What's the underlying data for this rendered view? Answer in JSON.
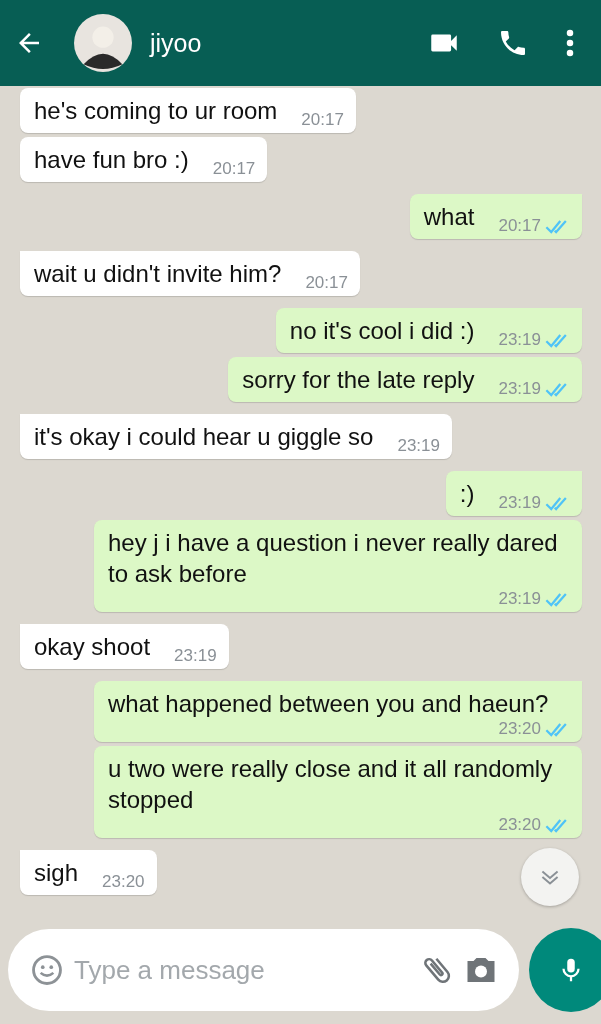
{
  "header": {
    "name": "jiyoo"
  },
  "messages": [
    {
      "kind": "incoming",
      "text": "he's coming to ur room",
      "time": "20:17",
      "tail": false
    },
    {
      "kind": "incoming",
      "text": "have fun bro :)",
      "time": "20:17",
      "tail": false
    },
    {
      "kind": "outgoing",
      "text": "what",
      "time": "20:17",
      "tail": true,
      "read": true
    },
    {
      "kind": "incoming",
      "text": "wait u didn't invite him?",
      "time": "20:17",
      "tail": true
    },
    {
      "kind": "outgoing",
      "text": "no it's cool i did :)",
      "time": "23:19",
      "tail": true,
      "read": true
    },
    {
      "kind": "outgoing",
      "text": "sorry for the late reply",
      "time": "23:19",
      "tail": false,
      "read": true
    },
    {
      "kind": "incoming",
      "text": "it's okay i could hear u giggle so",
      "time": "23:19",
      "tail": true
    },
    {
      "kind": "outgoing",
      "text": ":)",
      "time": "23:19",
      "tail": true,
      "read": true
    },
    {
      "kind": "outgoing",
      "text": "hey j i have a question i never really dared to ask before",
      "time": "23:19",
      "tail": false,
      "read": true
    },
    {
      "kind": "incoming",
      "text": "okay shoot",
      "time": "23:19",
      "tail": true
    },
    {
      "kind": "outgoing",
      "text": "what happened between you and haeun?",
      "time": "23:20",
      "tail": true,
      "read": true
    },
    {
      "kind": "outgoing",
      "text": "u two were really close and it all randomly stopped",
      "time": "23:20",
      "tail": false,
      "read": true
    },
    {
      "kind": "incoming",
      "text": "sigh",
      "time": "23:20",
      "tail": true
    }
  ],
  "composer": {
    "placeholder": "Type a message"
  }
}
